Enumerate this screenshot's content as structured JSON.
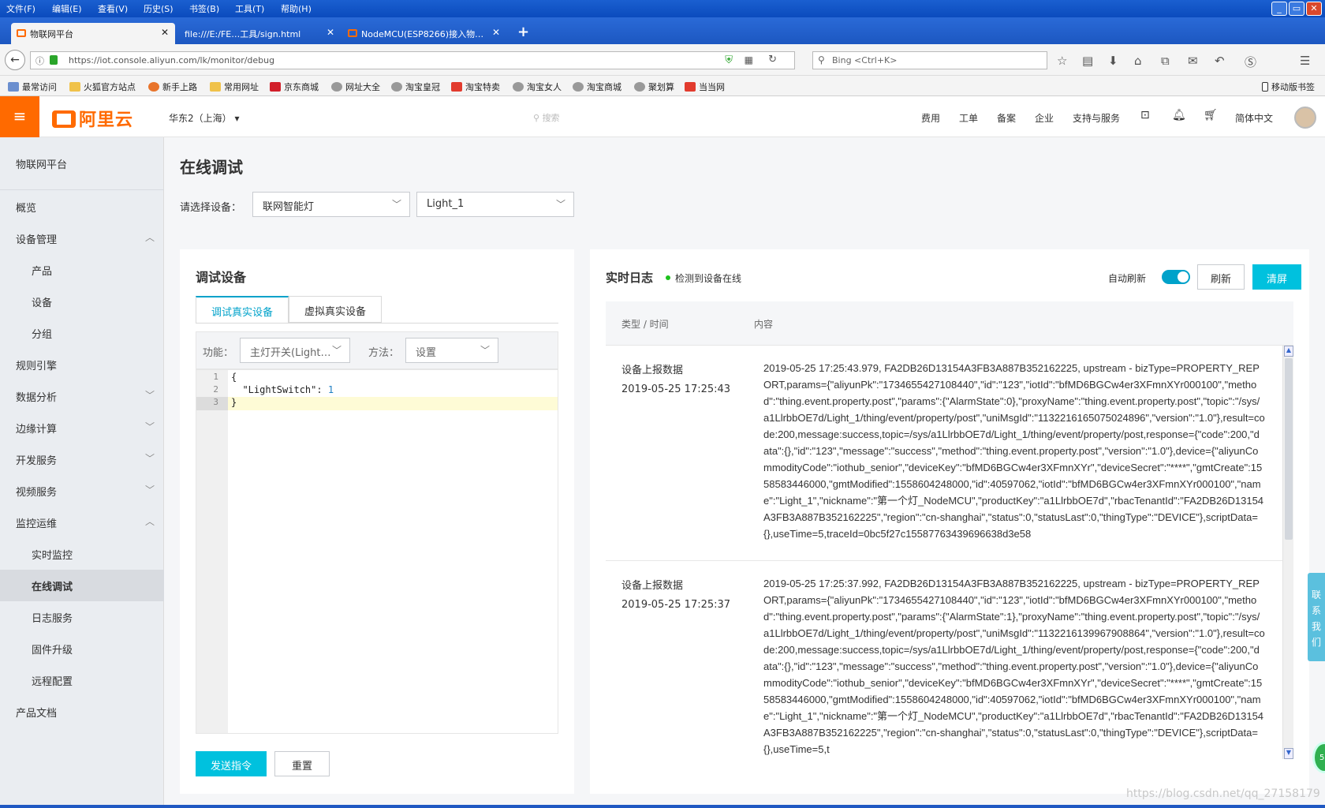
{
  "browser": {
    "menu": [
      "文件(F)",
      "编辑(E)",
      "查看(V)",
      "历史(S)",
      "书签(B)",
      "工具(T)",
      "帮助(H)"
    ],
    "window_controls": {
      "minimize": "_",
      "maximize": "▭",
      "close": "✕"
    },
    "tabs": [
      {
        "label": "物联网平台",
        "active": true
      },
      {
        "label": "file:///E:/FE…工具/sign.html",
        "active": false
      },
      {
        "label": "NodeMCU(ESP8266)接入物…",
        "active": false
      }
    ],
    "new_tab": "+",
    "url": "https://iot.console.aliyun.com/lk/monitor/debug",
    "search_placeholder": "Bing <Ctrl+K>",
    "bookmarks": [
      "最常访问",
      "火狐官方站点",
      "新手上路",
      "常用网址",
      "京东商城",
      "网址大全",
      "淘宝皇冠",
      "淘宝特卖",
      "淘宝女人",
      "淘宝商城",
      "聚划算",
      "当当网"
    ],
    "mobile_bookmarks": "移动版书签"
  },
  "console_header": {
    "logo": "阿里云",
    "region": "华东2（上海）",
    "search_placeholder": "搜索",
    "nav": [
      "费用",
      "工单",
      "备案",
      "企业",
      "支持与服务",
      "简体中文"
    ]
  },
  "sidebar": {
    "title": "物联网平台",
    "items": [
      {
        "label": "概览",
        "sub": false
      },
      {
        "label": "设备管理",
        "sub": false,
        "chevron": "︿"
      },
      {
        "label": "产品",
        "sub": true
      },
      {
        "label": "设备",
        "sub": true
      },
      {
        "label": "分组",
        "sub": true
      },
      {
        "label": "规则引擎",
        "sub": false
      },
      {
        "label": "数据分析",
        "sub": false,
        "chevron": "﹀"
      },
      {
        "label": "边缘计算",
        "sub": false,
        "chevron": "﹀"
      },
      {
        "label": "开发服务",
        "sub": false,
        "chevron": "﹀"
      },
      {
        "label": "视频服务",
        "sub": false,
        "chevron": "﹀"
      },
      {
        "label": "监控运维",
        "sub": false,
        "chevron": "︿"
      },
      {
        "label": "实时监控",
        "sub": true
      },
      {
        "label": "在线调试",
        "sub": true,
        "active": true
      },
      {
        "label": "日志服务",
        "sub": true
      },
      {
        "label": "固件升级",
        "sub": true
      },
      {
        "label": "远程配置",
        "sub": true
      },
      {
        "label": "产品文档",
        "sub": false
      }
    ]
  },
  "main": {
    "title": "在线调试",
    "device_label": "请选择设备：",
    "product_select": "联网智能灯",
    "device_select": "Light_1"
  },
  "debug": {
    "title": "调试设备",
    "tabs": [
      "调试真实设备",
      "虚拟真实设备"
    ],
    "function_label": "功能：",
    "function_value": "主灯开关(Light…",
    "method_label": "方法：",
    "method_value": "设置",
    "code_lines": [
      "{",
      "  \"LightSwitch\": 1",
      "}"
    ],
    "line_numbers": [
      "1",
      "2",
      "3"
    ],
    "send_label": "发送指令",
    "reset_label": "重置"
  },
  "log": {
    "title": "实时日志",
    "status": "检测到设备在线",
    "auto_refresh_label": "自动刷新",
    "auto_refresh_on": true,
    "refresh_label": "刷新",
    "clear_label": "清屏",
    "col_type": "类型 / 时间",
    "col_content": "内容",
    "entries": [
      {
        "type": "设备上报数据",
        "time": "2019-05-25 17:25:43",
        "content": "2019-05-25 17:25:43.979, FA2DB26D13154A3FB3A887B352162225, upstream - bizType=PROPERTY_REPORT,params={\"aliyunPk\":\"1734655427108440\",\"id\":\"123\",\"iotId\":\"bfMD6BGCw4er3XFmnXYr000100\",\"method\":\"thing.event.property.post\",\"params\":{\"AlarmState\":0},\"proxyName\":\"thing.event.property.post\",\"topic\":\"/sys/a1LlrbbOE7d/Light_1/thing/event/property/post\",\"uniMsgId\":\"1132216165075024896\",\"version\":\"1.0\"},result=code:200,message:success,topic=/sys/a1LlrbbOE7d/Light_1/thing/event/property/post,response={\"code\":200,\"data\":{},\"id\":\"123\",\"message\":\"success\",\"method\":\"thing.event.property.post\",\"version\":\"1.0\"},device={\"aliyunCommodityCode\":\"iothub_senior\",\"deviceKey\":\"bfMD6BGCw4er3XFmnXYr\",\"deviceSecret\":\"****\",\"gmtCreate\":1558583446000,\"gmtModified\":1558604248000,\"id\":40597062,\"iotId\":\"bfMD6BGCw4er3XFmnXYr000100\",\"name\":\"Light_1\",\"nickname\":\"第一个灯_NodeMCU\",\"productKey\":\"a1LlrbbOE7d\",\"rbacTenantId\":\"FA2DB26D13154A3FB3A887B352162225\",\"region\":\"cn-shanghai\",\"status\":0,\"statusLast\":0,\"thingType\":\"DEVICE\"},scriptData={},useTime=5,traceId=0bc5f27c15587763439696638d3e58"
      },
      {
        "type": "设备上报数据",
        "time": "2019-05-25 17:25:37",
        "content": "2019-05-25 17:25:37.992, FA2DB26D13154A3FB3A887B352162225, upstream - bizType=PROPERTY_REPORT,params={\"aliyunPk\":\"1734655427108440\",\"id\":\"123\",\"iotId\":\"bfMD6BGCw4er3XFmnXYr000100\",\"method\":\"thing.event.property.post\",\"params\":{\"AlarmState\":1},\"proxyName\":\"thing.event.property.post\",\"topic\":\"/sys/a1LlrbbOE7d/Light_1/thing/event/property/post\",\"uniMsgId\":\"1132216139967908864\",\"version\":\"1.0\"},result=code:200,message:success,topic=/sys/a1LlrbbOE7d/Light_1/thing/event/property/post,response={\"code\":200,\"data\":{},\"id\":\"123\",\"message\":\"success\",\"method\":\"thing.event.property.post\",\"version\":\"1.0\"},device={\"aliyunCommodityCode\":\"iothub_senior\",\"deviceKey\":\"bfMD6BGCw4er3XFmnXYr\",\"deviceSecret\":\"****\",\"gmtCreate\":1558583446000,\"gmtModified\":1558604248000,\"id\":40597062,\"iotId\":\"bfMD6BGCw4er3XFmnXYr000100\",\"name\":\"Light_1\",\"nickname\":\"第一个灯_NodeMCU\",\"productKey\":\"a1LlrbbOE7d\",\"rbacTenantId\":\"FA2DB26D13154A3FB3A887B352162225\",\"region\":\"cn-shanghai\",\"status\":0,\"statusLast\":0,\"thingType\":\"DEVICE\"},scriptData={},useTime=5,t"
      }
    ]
  },
  "contact_label": "联系我们",
  "float_badge": "5!",
  "watermark": "https://blog.csdn.net/qq_27158179",
  "colors": {
    "accent": "#00c1de",
    "brand": "#ff6a00",
    "sidebar_bg": "#eaedf1"
  }
}
